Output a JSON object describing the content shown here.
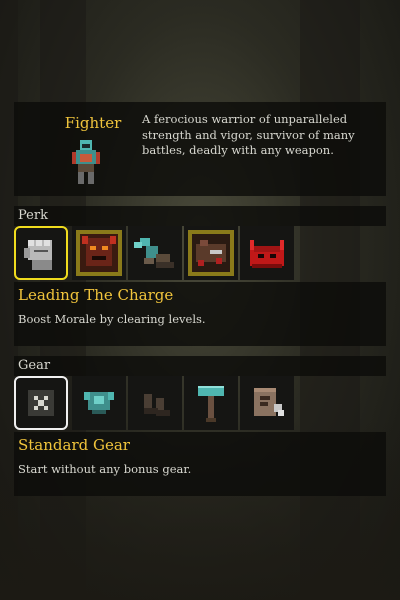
{
  "class_card": {
    "name": "Fighter",
    "description": "A ferocious warrior of unparalleled strength and vigor, survivor of many battles, deadly with any weapon.",
    "portrait_icon": "fighter-portrait"
  },
  "perk": {
    "section_label": "Perk",
    "slots": [
      {
        "icon": "gauntlet-fist-icon",
        "selected": true
      },
      {
        "icon": "demon-mask-icon",
        "selected": false
      },
      {
        "icon": "winged-boots-icon",
        "selected": false
      },
      {
        "icon": "bleeding-creature-icon",
        "selected": false
      },
      {
        "icon": "red-horned-helm-icon",
        "selected": false
      }
    ],
    "selected_title": "Leading The Charge",
    "selected_desc": "Boost Morale by clearing levels."
  },
  "gear": {
    "section_label": "Gear",
    "slots": [
      {
        "icon": "crossed-swords-icon",
        "selected": true
      },
      {
        "icon": "chest-armor-icon",
        "selected": false
      },
      {
        "icon": "boots-icon",
        "selected": false
      },
      {
        "icon": "hammer-icon",
        "selected": false
      },
      {
        "icon": "scroll-icon",
        "selected": false
      }
    ],
    "selected_title": "Standard Gear",
    "selected_desc": "Start without any bonus gear."
  },
  "colors": {
    "title_gold": "#f0c43c",
    "perk_select_border": "#f0dc1e",
    "gear_select_border": "#f0f0f0",
    "text": "#d8d8d0"
  }
}
